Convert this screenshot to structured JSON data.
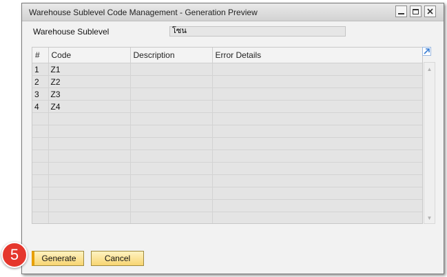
{
  "window": {
    "title": "Warehouse Sublevel Code Management - Generation Preview"
  },
  "field": {
    "label": "Warehouse Sublevel",
    "value": "โซน"
  },
  "grid": {
    "columns": [
      "#",
      "Code",
      "Description",
      "Error Details"
    ],
    "rows": [
      [
        "1",
        "Z1",
        "",
        ""
      ],
      [
        "2",
        "Z2",
        "",
        ""
      ],
      [
        "3",
        "Z3",
        "",
        ""
      ],
      [
        "4",
        "Z4",
        "",
        ""
      ],
      [
        "",
        "",
        "",
        ""
      ],
      [
        "",
        "",
        "",
        ""
      ],
      [
        "",
        "",
        "",
        ""
      ],
      [
        "",
        "",
        "",
        ""
      ],
      [
        "",
        "",
        "",
        ""
      ],
      [
        "",
        "",
        "",
        ""
      ],
      [
        "",
        "",
        "",
        ""
      ],
      [
        "",
        "",
        "",
        ""
      ],
      [
        "",
        "",
        "",
        ""
      ]
    ]
  },
  "buttons": {
    "generate_label": "Generate",
    "cancel_label": "Cancel"
  },
  "step_badge": "5",
  "colors": {
    "button_accent": "#e8a000",
    "button_face": "#f7d572",
    "badge": "#e5372d",
    "expand_icon": "#3b7fd4"
  },
  "icons": {
    "minimize": "minimize-icon",
    "maximize": "maximize-icon",
    "close": "close-icon",
    "expand": "expand-arrow-icon"
  }
}
